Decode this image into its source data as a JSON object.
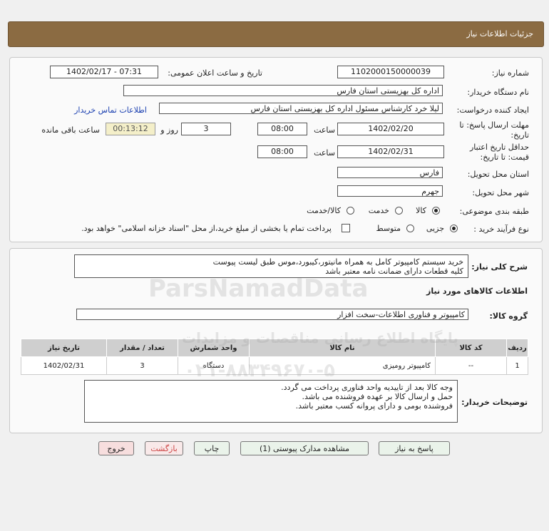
{
  "header": {
    "title": "جزئیات اطلاعات نیاز"
  },
  "form": {
    "need_number_label": "شماره نیاز:",
    "need_number": "1102000150000039",
    "announce_label": "تاریخ و ساعت اعلان عمومی:",
    "announce_value": "1402/02/17 - 07:31",
    "buyer_org_label": "نام دستگاه خریدار:",
    "buyer_org": "اداره کل بهزیستی استان فارس",
    "requester_label": "ایجاد کننده درخواست:",
    "requester": "لیلا خرد کارشناس مسئول اداره کل بهزیستی استان فارس",
    "contact_link": "اطلاعات تماس خریدار",
    "deadline_label_1": "مهلت ارسال پاسخ: تا",
    "deadline_label_2": "تاریخ:",
    "deadline_date": "1402/02/20",
    "time_label": "ساعت",
    "deadline_time": "08:00",
    "days_value": "3",
    "days_label": "روز و",
    "remaining_time": "00:13:12",
    "remaining_label": "ساعت باقی مانده",
    "validity_label_1": "حداقل تاریخ اعتبار",
    "validity_label_2": "قیمت: تا تاریخ:",
    "validity_date": "1402/02/31",
    "validity_time_label": "ساعت",
    "validity_time": "08:00",
    "province_label": "استان محل تحویل:",
    "province": "فارس",
    "city_label": "شهر محل تحویل:",
    "city": "جهرم",
    "category_label": "طبقه بندی موضوعی:",
    "category_options": [
      "کالا",
      "خدمت",
      "کالا/خدمت"
    ],
    "category_selected": "کالا",
    "process_label": "نوع فرآیند خرید :",
    "process_options": [
      "جزیی",
      "متوسط"
    ],
    "process_selected": "جزیی",
    "payment_note": "پرداخت تمام یا بخشی از مبلغ خرید،از محل \"اسناد خزانه اسلامی\" خواهد بود."
  },
  "description": {
    "label": "شرح کلی نیاز:",
    "line1": "خرید سیستم کامپیوتر کامل به همراه مانیتور،کیبورد،موس طبق لیست پیوست",
    "line2": "کلیه قطعات دارای ضمانت نامه معتبر باشد",
    "goods_info_title": "اطلاعات کالاهای مورد نیاز",
    "goods_group_label": "گروه کالا:",
    "goods_group": "کامپیوتر و فناوری اطلاعات-سخت افزار"
  },
  "table": {
    "headers": [
      "ردیف",
      "کد کالا",
      "نام کالا",
      "واحد شمارش",
      "تعداد / مقدار",
      "تاریخ نیاز"
    ],
    "rows": [
      {
        "index": "1",
        "code": "--",
        "name": "کامپیوتر رومیزی",
        "unit": "دستگاه",
        "qty": "3",
        "date": "1402/02/31"
      }
    ]
  },
  "buyer_notes": {
    "label": "توضیحات خریدار:",
    "line1": "وجه کالا بعد از تاییدیه واحد فناوری پرداخت می گردد.",
    "line2": "حمل و ارسال کالا بر عهده فروشنده می باشد.",
    "line3": "فروشنده بومی و دارای پروانه کسب معتبر باشد."
  },
  "buttons": {
    "reply": "پاسخ به نیاز",
    "attachments": "مشاهده مدارک پیوستی (1)",
    "print": "چاپ",
    "back": "بازگشت",
    "exit": "خروج"
  },
  "watermark": {
    "brand": "ParsNamadData",
    "line_fa": "پایگاه اطلاع رسانی مناقصات و مزایدات",
    "phone": "۰۲۱-۸۸۳۴۹۶۷۰-۵"
  }
}
